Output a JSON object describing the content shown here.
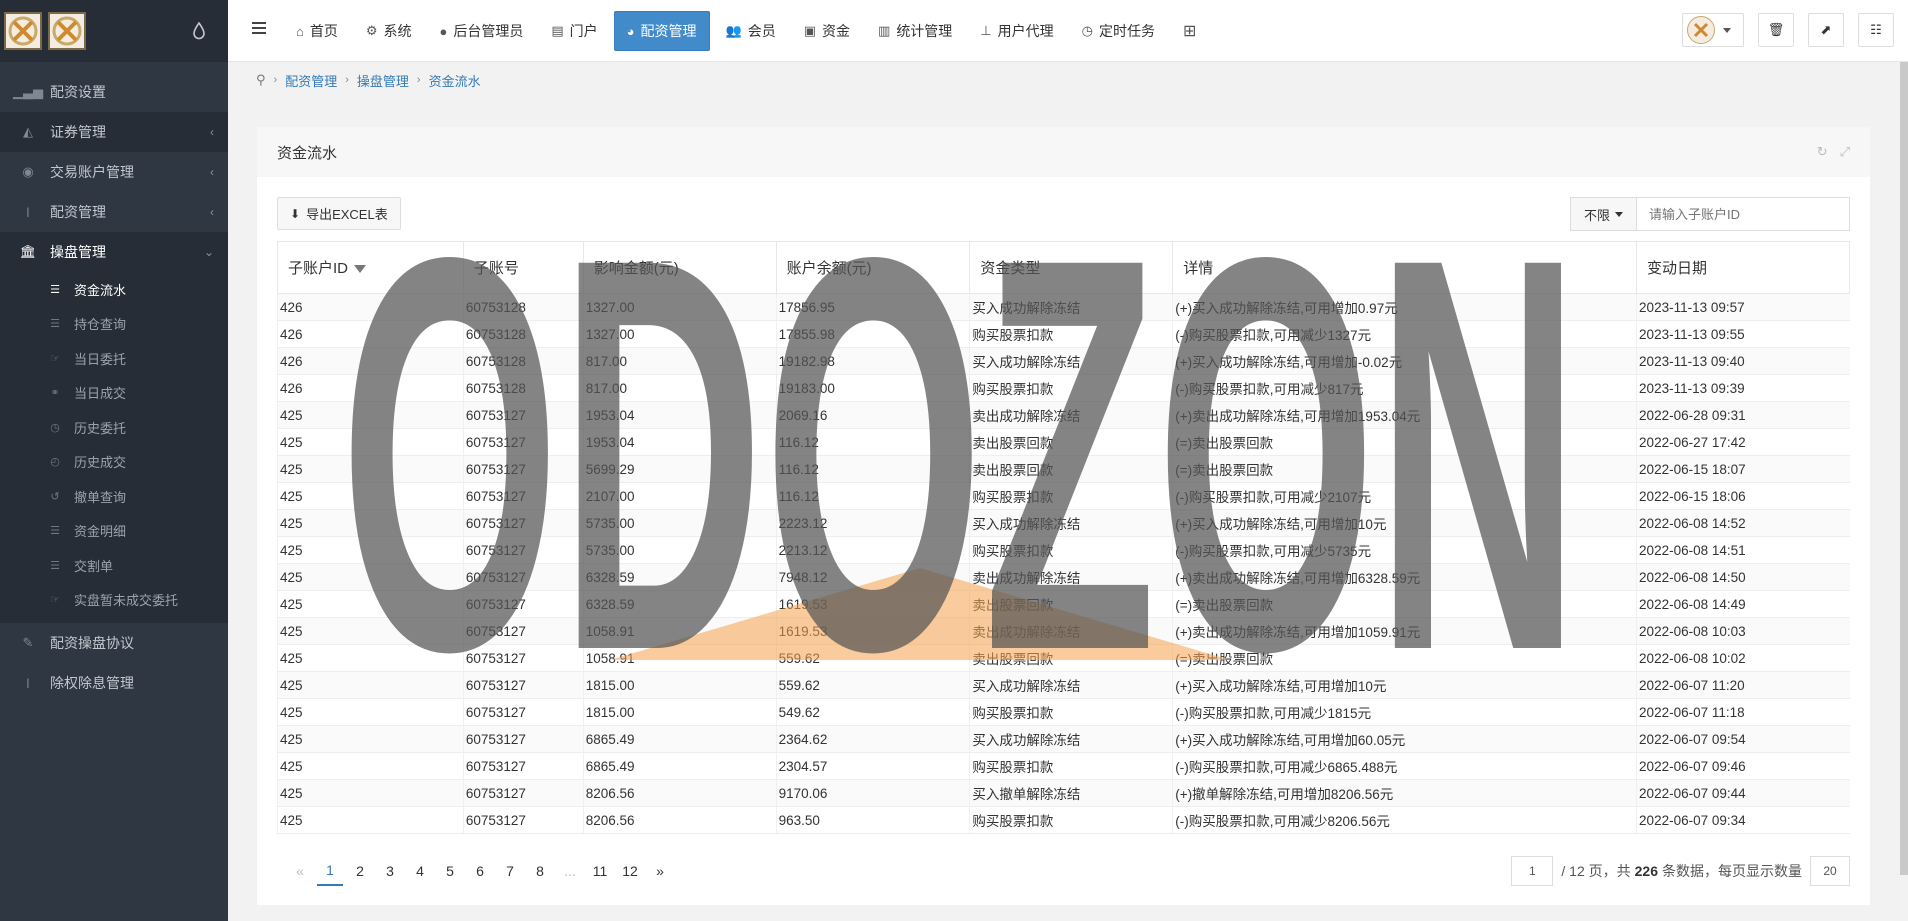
{
  "sidebar": {
    "items": [
      {
        "label": "配资设置",
        "icon": "signal-icon"
      },
      {
        "label": "证券管理",
        "icon": "area-chart-icon",
        "arrow": "‹"
      },
      {
        "label": "交易账户管理",
        "icon": "user-circle-icon",
        "arrow": "‹"
      },
      {
        "label": "配资管理",
        "icon": "thermometer-icon",
        "arrow": "‹"
      },
      {
        "label": "操盘管理",
        "icon": "bank-icon",
        "arrow": "⌄"
      }
    ],
    "subitems": [
      {
        "label": "资金流水",
        "icon": "list-icon"
      },
      {
        "label": "持仓查询",
        "icon": "list-icon"
      },
      {
        "label": "当日委托",
        "icon": "hand-icon"
      },
      {
        "label": "当日成交",
        "icon": "handshake-icon"
      },
      {
        "label": "历史委托",
        "icon": "clock-icon"
      },
      {
        "label": "历史成交",
        "icon": "history-icon"
      },
      {
        "label": "撤单查询",
        "icon": "undo-icon"
      },
      {
        "label": "资金明细",
        "icon": "list-icon"
      },
      {
        "label": "交割单",
        "icon": "list-icon"
      },
      {
        "label": "实盘暂未成交委托",
        "icon": "hand-icon"
      }
    ],
    "bottom_items": [
      {
        "label": "配资操盘协议",
        "icon": "pencil-icon"
      },
      {
        "label": "除权除息管理",
        "icon": "thermometer-icon"
      }
    ]
  },
  "topnav": {
    "items": [
      {
        "label": "首页",
        "icon": "home-icon"
      },
      {
        "label": "系统",
        "icon": "gear-icon"
      },
      {
        "label": "后台管理员",
        "icon": "user-icon"
      },
      {
        "label": "门户",
        "icon": "newspaper-icon"
      },
      {
        "label": "配资管理",
        "icon": "pie-chart-icon"
      },
      {
        "label": "会员",
        "icon": "users-icon"
      },
      {
        "label": "资金",
        "icon": "money-icon"
      },
      {
        "label": "统计管理",
        "icon": "bar-chart-icon"
      },
      {
        "label": "用户代理",
        "icon": "sitemap-icon"
      },
      {
        "label": "定时任务",
        "icon": "clock-icon"
      }
    ]
  },
  "breadcrumb": [
    "配资管理",
    "操盘管理",
    "资金流水"
  ],
  "panel": {
    "title": "资金流水"
  },
  "toolbar": {
    "export_label": "导出EXCEL表",
    "filter_label": "不限",
    "search_placeholder": "请输入子账户ID"
  },
  "table": {
    "headers": [
      "子账户ID",
      "子账号",
      "影响金额(元)",
      "账户余额(元)",
      "资金类型",
      "详情",
      "变动日期"
    ],
    "rows": [
      [
        "426",
        "60753128",
        "1327.00",
        "17856.95",
        "买入成功解除冻结",
        "(+)买入成功解除冻结,可用增加0.97元",
        "2023-11-13 09:57"
      ],
      [
        "426",
        "60753128",
        "1327.00",
        "17855.98",
        "购买股票扣款",
        "(-)购买股票扣款,可用减少1327元",
        "2023-11-13 09:55"
      ],
      [
        "426",
        "60753128",
        "817.00",
        "19182.98",
        "买入成功解除冻结",
        "(+)买入成功解除冻结,可用增加-0.02元",
        "2023-11-13 09:40"
      ],
      [
        "426",
        "60753128",
        "817.00",
        "19183.00",
        "购买股票扣款",
        "(-)购买股票扣款,可用减少817元",
        "2023-11-13 09:39"
      ],
      [
        "425",
        "60753127",
        "1953.04",
        "2069.16",
        "卖出成功解除冻结",
        "(+)卖出成功解除冻结,可用增加1953.04元",
        "2022-06-28 09:31"
      ],
      [
        "425",
        "60753127",
        "1953.04",
        "116.12",
        "卖出股票回款",
        "(=)卖出股票回款",
        "2022-06-27 17:42"
      ],
      [
        "425",
        "60753127",
        "5699.29",
        "116.12",
        "卖出股票回款",
        "(=)卖出股票回款",
        "2022-06-15 18:07"
      ],
      [
        "425",
        "60753127",
        "2107.00",
        "116.12",
        "购买股票扣款",
        "(-)购买股票扣款,可用减少2107元",
        "2022-06-15 18:06"
      ],
      [
        "425",
        "60753127",
        "5735.00",
        "2223.12",
        "买入成功解除冻结",
        "(+)买入成功解除冻结,可用增加10元",
        "2022-06-08 14:52"
      ],
      [
        "425",
        "60753127",
        "5735.00",
        "2213.12",
        "购买股票扣款",
        "(-)购买股票扣款,可用减少5735元",
        "2022-06-08 14:51"
      ],
      [
        "425",
        "60753127",
        "6328.59",
        "7948.12",
        "卖出成功解除冻结",
        "(+)卖出成功解除冻结,可用增加6328.59元",
        "2022-06-08 14:50"
      ],
      [
        "425",
        "60753127",
        "6328.59",
        "1619.53",
        "卖出股票回款",
        "(=)卖出股票回款",
        "2022-06-08 14:49"
      ],
      [
        "425",
        "60753127",
        "1058.91",
        "1619.53",
        "卖出成功解除冻结",
        "(+)卖出成功解除冻结,可用增加1059.91元",
        "2022-06-08 10:03"
      ],
      [
        "425",
        "60753127",
        "1058.91",
        "559.62",
        "卖出股票回款",
        "(=)卖出股票回款",
        "2022-06-08 10:02"
      ],
      [
        "425",
        "60753127",
        "1815.00",
        "559.62",
        "买入成功解除冻结",
        "(+)买入成功解除冻结,可用增加10元",
        "2022-06-07 11:20"
      ],
      [
        "425",
        "60753127",
        "1815.00",
        "549.62",
        "购买股票扣款",
        "(-)购买股票扣款,可用减少1815元",
        "2022-06-07 11:18"
      ],
      [
        "425",
        "60753127",
        "6865.49",
        "2364.62",
        "买入成功解除冻结",
        "(+)买入成功解除冻结,可用增加60.05元",
        "2022-06-07 09:54"
      ],
      [
        "425",
        "60753127",
        "6865.49",
        "2304.57",
        "购买股票扣款",
        "(-)购买股票扣款,可用减少6865.488元",
        "2022-06-07 09:46"
      ],
      [
        "425",
        "60753127",
        "8206.56",
        "9170.06",
        "买入撤单解除冻结",
        "(+)撤单解除冻结,可用增加8206.56元",
        "2022-06-07 09:44"
      ],
      [
        "425",
        "60753127",
        "8206.56",
        "963.50",
        "购买股票扣款",
        "(-)购买股票扣款,可用减少8206.56元",
        "2022-06-07 09:34"
      ]
    ]
  },
  "pagination": {
    "prev": "«",
    "pages": [
      "1",
      "2",
      "3",
      "4",
      "5",
      "6",
      "7",
      "8",
      "...",
      "11",
      "12"
    ],
    "next": "»",
    "current_page": "1",
    "total_pages_text": "/ 12 页，共",
    "total_count": "226",
    "count_suffix": "条数据，每页显示数量",
    "page_size": "20"
  },
  "watermark": {
    "text": "ODOZON",
    "colors": {
      "text": "#555555",
      "triangle": "#f5a04a"
    }
  },
  "colors": {
    "accent": "#428bca",
    "sidebar_bg": "#2f3742",
    "link": "#337ab7"
  }
}
